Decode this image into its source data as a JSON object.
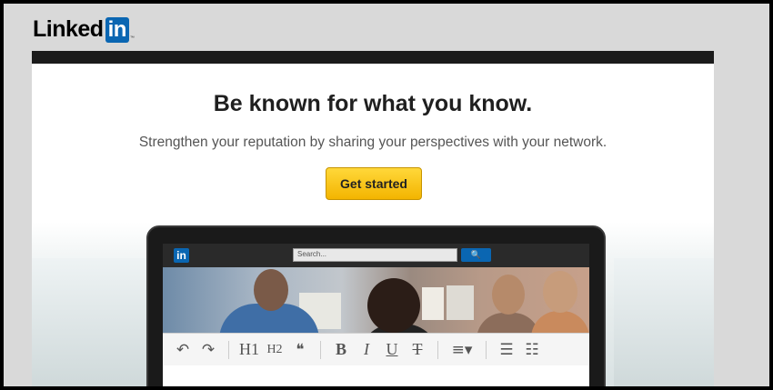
{
  "brand": {
    "logo_word": "Linked",
    "logo_box": "in",
    "logo_tm": "™"
  },
  "hero": {
    "headline": "Be known for what you know.",
    "subline": "Strengthen your reputation by sharing your perspectives with your network.",
    "cta_label": "Get started"
  },
  "colors": {
    "brand_blue": "#0a66b2",
    "cta_yellow": "#f3b400",
    "header_dark": "#1b1b1b"
  },
  "device": {
    "mini_logo": "in",
    "search_placeholder": "Search...",
    "search_icon": "🔍"
  },
  "toolbar": {
    "undo": "↶",
    "redo": "↷",
    "h1": "H1",
    "h2": "H2",
    "quote": "❝",
    "bold": "B",
    "italic": "I",
    "underline": "U",
    "strike": "T",
    "align": "≡▾",
    "bullets": "☰",
    "numbers": "☷"
  },
  "icons": {
    "undo": "undo-icon",
    "redo": "redo-icon",
    "search": "search-icon"
  }
}
